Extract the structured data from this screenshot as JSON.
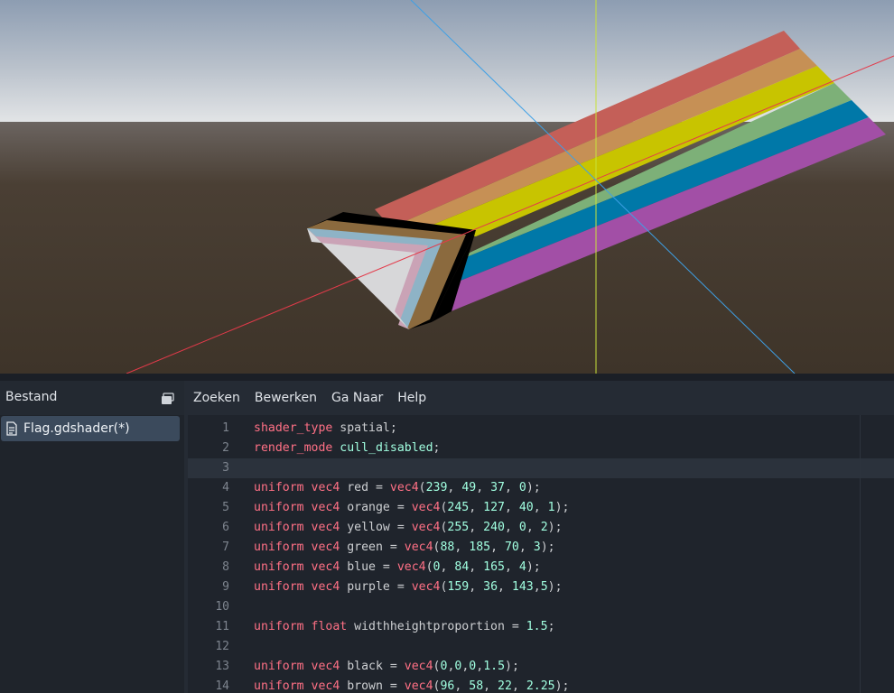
{
  "viewport": {
    "sky_top": "#8fa0b5",
    "horizon": "#d9dcdf",
    "ground": "#3f352b",
    "axis_x_color": "#e33a4a",
    "axis_y_color": "#c8e23a",
    "axis_z_color": "#3ea0e6",
    "flag_colors": [
      "#c45f58",
      "#c69055",
      "#c8c400",
      "#7db078",
      "#0078a8",
      "#a24fa6"
    ],
    "chevron_colors": [
      "#000000",
      "#8b6a3e",
      "#8eb3c6",
      "#caa3b6",
      "#d7d7d9"
    ]
  },
  "file_panel": {
    "title": "Bestand",
    "toggle_icon": "panel-toggle-icon",
    "files": [
      {
        "label": "Flag.gdshader(*)",
        "icon": "shader-file-icon",
        "selected": true
      }
    ]
  },
  "menubar": {
    "items": [
      "Zoeken",
      "Bewerken",
      "Ga Naar",
      "Help"
    ]
  },
  "editor": {
    "current_line": 3,
    "lines": [
      {
        "n": "1",
        "tokens": [
          [
            "kw",
            "shader_type"
          ],
          [
            "id",
            " spatial;"
          ]
        ]
      },
      {
        "n": "2",
        "tokens": [
          [
            "kw",
            "render_mode"
          ],
          [
            "id",
            " "
          ],
          [
            "val",
            "cull_disabled"
          ],
          [
            "id",
            ";"
          ]
        ]
      },
      {
        "n": "3",
        "tokens": []
      },
      {
        "n": "4",
        "tokens": [
          [
            "kw",
            "uniform"
          ],
          [
            "id",
            " "
          ],
          [
            "kw",
            "vec4"
          ],
          [
            "id",
            " red = "
          ],
          [
            "fn",
            "vec4"
          ],
          [
            "id",
            "("
          ],
          [
            "num",
            "239"
          ],
          [
            "id",
            ", "
          ],
          [
            "num",
            "49"
          ],
          [
            "id",
            ", "
          ],
          [
            "num",
            "37"
          ],
          [
            "id",
            ", "
          ],
          [
            "num",
            "0"
          ],
          [
            "id",
            ");"
          ]
        ]
      },
      {
        "n": "5",
        "tokens": [
          [
            "kw",
            "uniform"
          ],
          [
            "id",
            " "
          ],
          [
            "kw",
            "vec4"
          ],
          [
            "id",
            " orange = "
          ],
          [
            "fn",
            "vec4"
          ],
          [
            "id",
            "("
          ],
          [
            "num",
            "245"
          ],
          [
            "id",
            ", "
          ],
          [
            "num",
            "127"
          ],
          [
            "id",
            ", "
          ],
          [
            "num",
            "40"
          ],
          [
            "id",
            ", "
          ],
          [
            "num",
            "1"
          ],
          [
            "id",
            ");"
          ]
        ]
      },
      {
        "n": "6",
        "tokens": [
          [
            "kw",
            "uniform"
          ],
          [
            "id",
            " "
          ],
          [
            "kw",
            "vec4"
          ],
          [
            "id",
            " yellow = "
          ],
          [
            "fn",
            "vec4"
          ],
          [
            "id",
            "("
          ],
          [
            "num",
            "255"
          ],
          [
            "id",
            ", "
          ],
          [
            "num",
            "240"
          ],
          [
            "id",
            ", "
          ],
          [
            "num",
            "0"
          ],
          [
            "id",
            ", "
          ],
          [
            "num",
            "2"
          ],
          [
            "id",
            ");"
          ]
        ]
      },
      {
        "n": "7",
        "tokens": [
          [
            "kw",
            "uniform"
          ],
          [
            "id",
            " "
          ],
          [
            "kw",
            "vec4"
          ],
          [
            "id",
            " green = "
          ],
          [
            "fn",
            "vec4"
          ],
          [
            "id",
            "("
          ],
          [
            "num",
            "88"
          ],
          [
            "id",
            ", "
          ],
          [
            "num",
            "185"
          ],
          [
            "id",
            ", "
          ],
          [
            "num",
            "70"
          ],
          [
            "id",
            ", "
          ],
          [
            "num",
            "3"
          ],
          [
            "id",
            ");"
          ]
        ]
      },
      {
        "n": "8",
        "tokens": [
          [
            "kw",
            "uniform"
          ],
          [
            "id",
            " "
          ],
          [
            "kw",
            "vec4"
          ],
          [
            "id",
            " blue = "
          ],
          [
            "fn",
            "vec4"
          ],
          [
            "id",
            "("
          ],
          [
            "num",
            "0"
          ],
          [
            "id",
            ", "
          ],
          [
            "num",
            "84"
          ],
          [
            "id",
            ", "
          ],
          [
            "num",
            "165"
          ],
          [
            "id",
            ", "
          ],
          [
            "num",
            "4"
          ],
          [
            "id",
            ");"
          ]
        ]
      },
      {
        "n": "9",
        "tokens": [
          [
            "kw",
            "uniform"
          ],
          [
            "id",
            " "
          ],
          [
            "kw",
            "vec4"
          ],
          [
            "id",
            " purple = "
          ],
          [
            "fn",
            "vec4"
          ],
          [
            "id",
            "("
          ],
          [
            "num",
            "159"
          ],
          [
            "id",
            ", "
          ],
          [
            "num",
            "36"
          ],
          [
            "id",
            ", "
          ],
          [
            "num",
            "143"
          ],
          [
            "id",
            ","
          ],
          [
            "num",
            "5"
          ],
          [
            "id",
            ");"
          ]
        ]
      },
      {
        "n": "10",
        "tokens": []
      },
      {
        "n": "11",
        "tokens": [
          [
            "kw",
            "uniform"
          ],
          [
            "id",
            " "
          ],
          [
            "kw",
            "float"
          ],
          [
            "id",
            " widthheightproportion = "
          ],
          [
            "num",
            "1.5"
          ],
          [
            "id",
            ";"
          ]
        ]
      },
      {
        "n": "12",
        "tokens": []
      },
      {
        "n": "13",
        "tokens": [
          [
            "kw",
            "uniform"
          ],
          [
            "id",
            " "
          ],
          [
            "kw",
            "vec4"
          ],
          [
            "id",
            " black = "
          ],
          [
            "fn",
            "vec4"
          ],
          [
            "id",
            "("
          ],
          [
            "num",
            "0"
          ],
          [
            "id",
            ","
          ],
          [
            "num",
            "0"
          ],
          [
            "id",
            ","
          ],
          [
            "num",
            "0"
          ],
          [
            "id",
            ","
          ],
          [
            "num",
            "1.5"
          ],
          [
            "id",
            ");"
          ]
        ]
      },
      {
        "n": "14",
        "tokens": [
          [
            "kw",
            "uniform"
          ],
          [
            "id",
            " "
          ],
          [
            "kw",
            "vec4"
          ],
          [
            "id",
            " brown = "
          ],
          [
            "fn",
            "vec4"
          ],
          [
            "id",
            "("
          ],
          [
            "num",
            "96"
          ],
          [
            "id",
            ", "
          ],
          [
            "num",
            "58"
          ],
          [
            "id",
            ", "
          ],
          [
            "num",
            "22"
          ],
          [
            "id",
            ", "
          ],
          [
            "num",
            "2.25"
          ],
          [
            "id",
            ");"
          ]
        ]
      }
    ]
  }
}
